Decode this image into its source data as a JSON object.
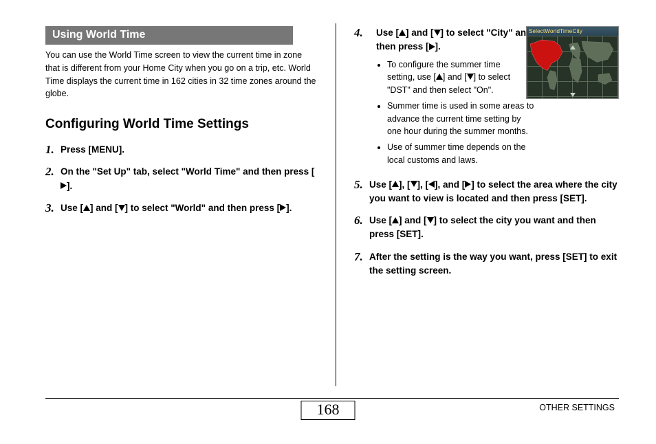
{
  "section_header": "Using World Time",
  "intro": "You can use the World Time screen to view the current time in zone that is different from your Home City when you go on a trip, etc. World Time displays the current time in 162 cities in 32 time zones around the globe.",
  "subheading": "Configuring World Time Settings",
  "steps_left": [
    {
      "num": "1.",
      "segments": [
        {
          "t": "Press [MENU]."
        }
      ]
    },
    {
      "num": "2.",
      "segments": [
        {
          "t": "On the \"Set Up\" tab, select \"World Time\" and then press ["
        },
        {
          "icon": "right"
        },
        {
          "t": "]."
        }
      ]
    },
    {
      "num": "3.",
      "segments": [
        {
          "t": "Use ["
        },
        {
          "icon": "up"
        },
        {
          "t": "] and ["
        },
        {
          "icon": "down"
        },
        {
          "t": "] to select \"World\" and then press ["
        },
        {
          "icon": "right"
        },
        {
          "t": "]."
        }
      ]
    }
  ],
  "step4": {
    "num": "4.",
    "segments": [
      {
        "t": "Use ["
      },
      {
        "icon": "up"
      },
      {
        "t": "] and ["
      },
      {
        "icon": "down"
      },
      {
        "t": "] to select \"City\" and then press ["
      },
      {
        "icon": "right"
      },
      {
        "t": "]."
      }
    ],
    "bullets": [
      [
        {
          "t": "To configure the summer time setting, use ["
        },
        {
          "icon": "up"
        },
        {
          "t": "] and ["
        },
        {
          "icon": "down"
        },
        {
          "t": "] to select \"DST\" and then select \"On\"."
        }
      ],
      [
        {
          "t": "Summer time is used in some areas to advance the current time setting by one hour during the summer months."
        }
      ],
      [
        {
          "t": "Use of summer time depends on the local customs and laws."
        }
      ]
    ]
  },
  "map_title": "SelectWorldTimeCity",
  "steps_right_rest": [
    {
      "num": "5.",
      "segments": [
        {
          "t": "Use ["
        },
        {
          "icon": "up"
        },
        {
          "t": "], ["
        },
        {
          "icon": "down"
        },
        {
          "t": "], ["
        },
        {
          "icon": "left"
        },
        {
          "t": "], and ["
        },
        {
          "icon": "right"
        },
        {
          "t": "] to select the area where the city you want to view is located and then press [SET]."
        }
      ]
    },
    {
      "num": "6.",
      "segments": [
        {
          "t": "Use ["
        },
        {
          "icon": "up"
        },
        {
          "t": "] and ["
        },
        {
          "icon": "down"
        },
        {
          "t": "] to select the city you want and then press [SET]."
        }
      ]
    },
    {
      "num": "7.",
      "segments": [
        {
          "t": "After the setting is the way you want, press [SET] to exit the setting screen."
        }
      ]
    }
  ],
  "page_number": "168",
  "footer_label": "OTHER SETTINGS"
}
